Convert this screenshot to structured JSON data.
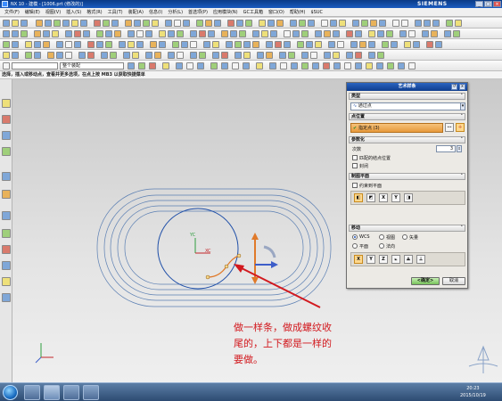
{
  "window": {
    "title": "NX 10 - 建模 - [1006.prt (修改的)]",
    "brand": "SIEMENS",
    "btn_min": "_",
    "btn_max": "□",
    "btn_close": "×"
  },
  "menu": [
    "文件(F)",
    "编辑(E)",
    "视图(V)",
    "插入(S)",
    "格式(R)",
    "工具(T)",
    "装配(A)",
    "信息(I)",
    "分析(L)",
    "首选项(P)",
    "应用模块(N)",
    "GC工具箱",
    "窗口(O)",
    "帮助(H)",
    "$SUC"
  ],
  "toolbar": {
    "filter_value": "整个装配"
  },
  "cue": "选择，插入或移动点，查看并更多选项，在点上按 MB3 以获取快捷菜单",
  "dialog": {
    "title": "艺术样条",
    "hdr_reset": "↺",
    "hdr_close": "x",
    "type_group": "类型",
    "type_value": "通过点",
    "points_group": "点位置",
    "points_value": "指定点 (3)",
    "param_group": "参数化",
    "degree_label": "次数",
    "degree_value": "3",
    "matches_knot": "匹配的结点位置",
    "closed": "封闭",
    "plane_group": "制图平面",
    "constrain_plane": "约束到平面",
    "move_group": "移动",
    "move_options": [
      "WCS",
      "视图",
      "矢量",
      "平面",
      "法向"
    ],
    "axis_buttons": [
      "X",
      "Y",
      "Z"
    ],
    "ok": "<确定>",
    "cancel": "取消"
  },
  "canvas": {
    "wcs_y": "YC",
    "wcs_x": "XC",
    "annotation": [
      "做一样条，做成螺纹收",
      "尾的，上下都是一样的",
      "要做。"
    ]
  },
  "taskbar": {
    "time": "20:23",
    "date": "2015/10/19"
  },
  "colors": {
    "title_blue": "#0e3d8e",
    "annotation_red": "#d2191e",
    "curve_blue": "#4a6fa5",
    "highlight_orange": "#e07a2a"
  }
}
